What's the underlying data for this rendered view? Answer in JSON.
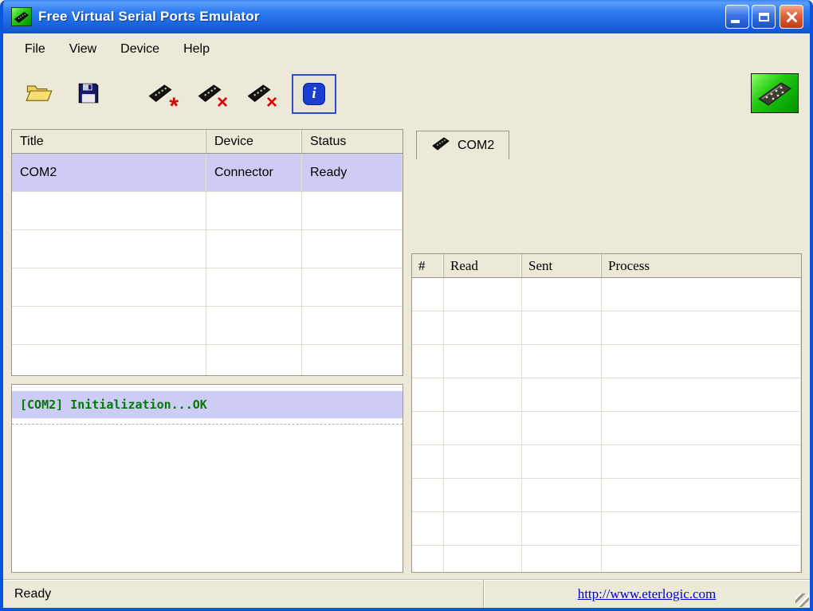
{
  "window": {
    "title": "Free Virtual Serial Ports Emulator"
  },
  "menu": {
    "items": [
      "File",
      "View",
      "Device",
      "Help"
    ]
  },
  "toolbar": {
    "buttons": [
      {
        "name": "open",
        "icon": "open-folder-icon"
      },
      {
        "name": "save",
        "icon": "save-floppy-icon"
      },
      {
        "name": "create-device",
        "icon": "device-create-icon"
      },
      {
        "name": "delete-device",
        "icon": "device-delete-icon"
      },
      {
        "name": "delete-all-devices",
        "icon": "device-delete-all-icon"
      },
      {
        "name": "about",
        "icon": "info-icon"
      }
    ],
    "logo_icon": "serial-connector-icon"
  },
  "devices_table": {
    "columns": [
      "Title",
      "Device",
      "Status"
    ],
    "rows": [
      {
        "title": "COM2",
        "device": "Connector",
        "status": "Ready"
      }
    ]
  },
  "log": {
    "lines": [
      "[COM2] Initialization...OK"
    ]
  },
  "tabs": {
    "active": "COM2"
  },
  "activity_table": {
    "columns": [
      "#",
      "Read",
      "Sent",
      "Process"
    ],
    "rows": []
  },
  "statusbar": {
    "status": "Ready",
    "link": "http://www.eterlogic.com"
  },
  "colors": {
    "highlight": "#cdccf4",
    "log_text": "#007b00",
    "link": "#0000cc",
    "titlebar": "#1b63dd"
  }
}
